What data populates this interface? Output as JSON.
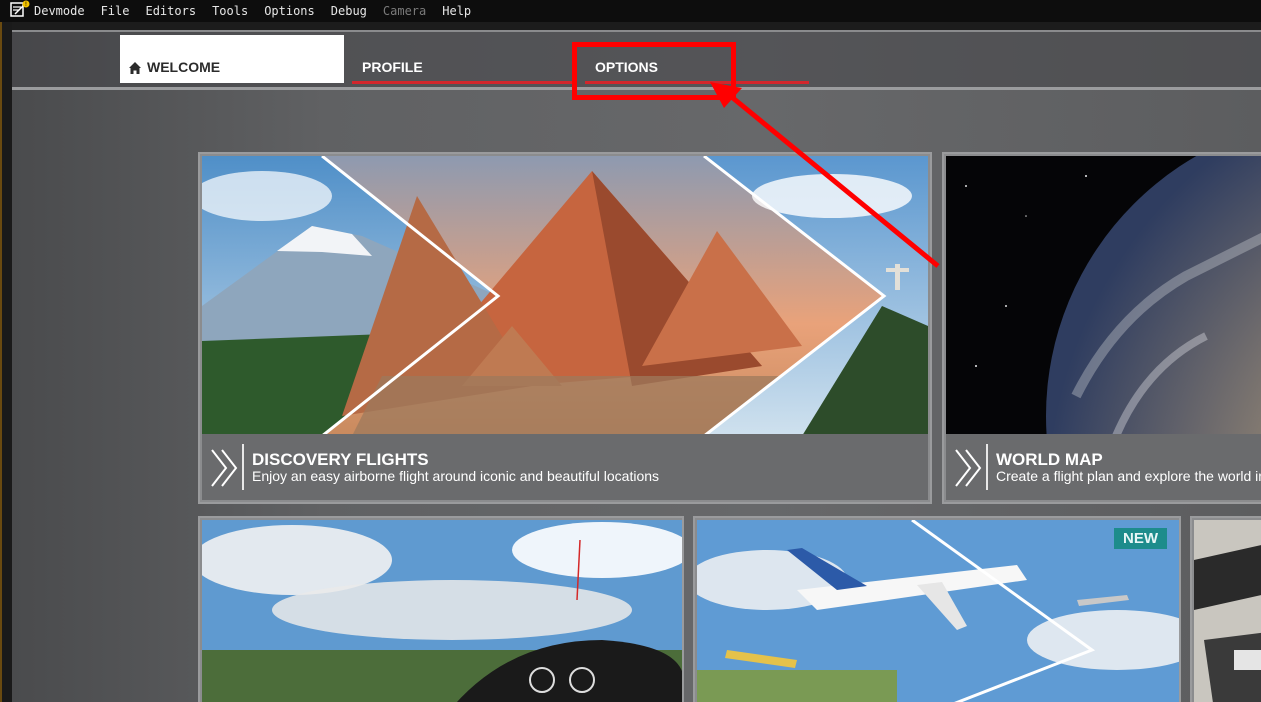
{
  "menubar": {
    "items": [
      "Devmode",
      "File",
      "Editors",
      "Tools",
      "Options",
      "Debug",
      "Camera",
      "Help"
    ],
    "disabled": [
      "Camera"
    ]
  },
  "tabs": [
    {
      "label": "WELCOME",
      "active": true,
      "icon": "home-icon"
    },
    {
      "label": "PROFILE",
      "active": false
    },
    {
      "label": "OPTIONS",
      "active": false
    }
  ],
  "annotation": {
    "color": "#ff0000",
    "target": "OPTIONS tab"
  },
  "cards": {
    "discovery": {
      "title": "DISCOVERY FLIGHTS",
      "subtitle": "Enjoy an easy airborne flight around iconic and beautiful locations"
    },
    "worldmap": {
      "title": "WORLD MAP",
      "subtitle": "Create a flight plan and explore the world in"
    },
    "bottom_middle": {
      "badge": "NEW"
    }
  },
  "colors": {
    "accent_red": "#d2262c",
    "badge_teal": "#1d8c8c",
    "tab_active_bg": "#ffffff"
  }
}
